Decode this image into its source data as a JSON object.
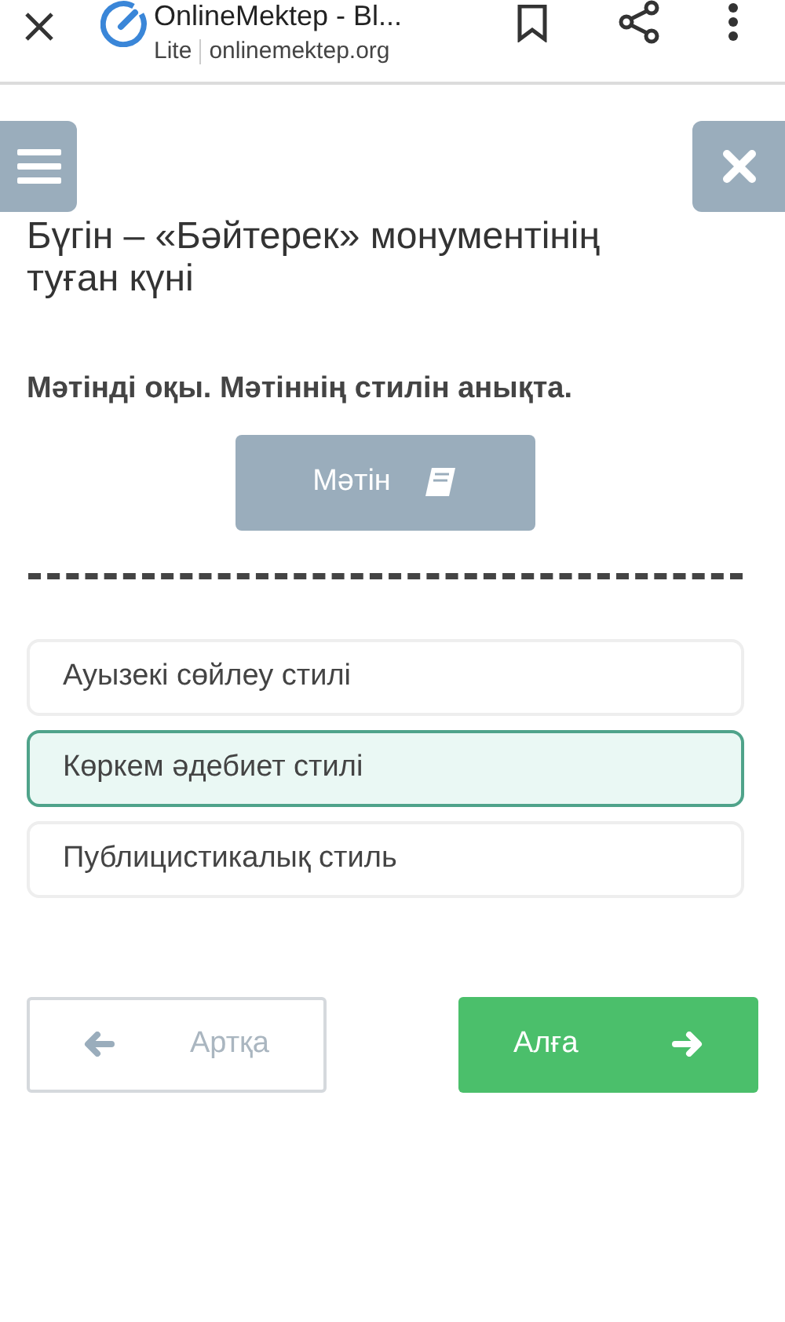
{
  "browser_bar": {
    "title": "OnlineMektep - Bl...",
    "badge": "Lite",
    "url": "onlinemektep.org"
  },
  "title": "Бүгін – «Бәйтерек» монументінің туған күні",
  "question": "Мәтінді оқы. Мәтіннің стилін анықта.",
  "text_button": {
    "label": "Мәтін"
  },
  "options": [
    {
      "label": "Ауызекі сөйлеу стилі",
      "selected": false
    },
    {
      "label": "Көркем әдебиет стилі",
      "selected": true
    },
    {
      "label": "Публицистикалық стиль",
      "selected": false
    }
  ],
  "nav": {
    "back": {
      "label": "Артқа",
      "disabled": true
    },
    "next": {
      "label": "Алға",
      "disabled": false
    }
  }
}
